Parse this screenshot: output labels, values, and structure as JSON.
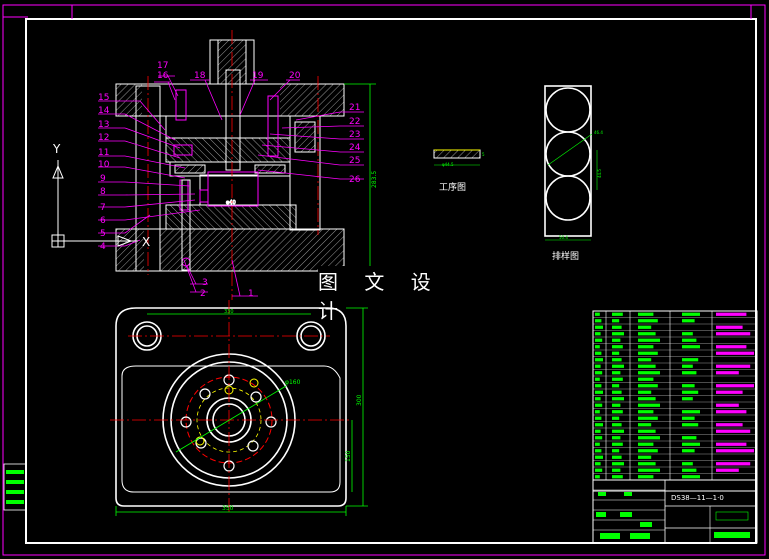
{
  "watermark": "图 文 设 计",
  "captions": {
    "process_view": "工序图",
    "layout_view": "排样图"
  },
  "part_numbers": [
    "1",
    "2",
    "3",
    "4",
    "5",
    "6",
    "7",
    "8",
    "9",
    "10",
    "11",
    "12",
    "13",
    "14",
    "15",
    "16",
    "17",
    "18",
    "19",
    "20",
    "21",
    "22",
    "23",
    "24",
    "25",
    "26"
  ],
  "axis_labels": {
    "y": "Y",
    "x": "X"
  },
  "dimensions": {
    "total_height": "283.5",
    "die_dia": "φ40",
    "punch_dia": "φ40",
    "plan_top_width": "330",
    "plan_overall_width": "350",
    "plan_height": "300",
    "plan_half_height": "150",
    "bolt_circle": "φ160",
    "part_dia": "φ44.5",
    "part_height": "5",
    "strip_pitch": "44.5",
    "strip_dim": "46.4",
    "strip_width": "50.4"
  },
  "title_block": {
    "drawing_code": "DS38—11—1·0"
  },
  "colors": {
    "line": "#ffffff",
    "part": "#ff00ff",
    "green": "#00ff00",
    "center": "#ff0000",
    "yellow": "#ffff00",
    "cyan": "#00ffff",
    "bg": "#000000"
  }
}
